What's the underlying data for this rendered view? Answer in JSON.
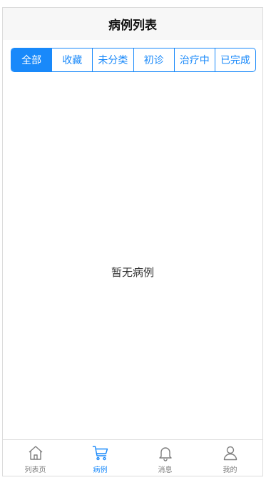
{
  "header": {
    "title": "病例列表"
  },
  "segments": [
    {
      "label": "全部",
      "active": true
    },
    {
      "label": "收藏",
      "active": false
    },
    {
      "label": "未分类",
      "active": false
    },
    {
      "label": "初诊",
      "active": false
    },
    {
      "label": "治疗中",
      "active": false
    },
    {
      "label": "已完成",
      "active": false
    }
  ],
  "empty_state": {
    "text": "暂无病例"
  },
  "tabbar": {
    "items": [
      {
        "label": "列表页",
        "icon": "home-icon",
        "active": false
      },
      {
        "label": "病例",
        "icon": "cart-icon",
        "active": true
      },
      {
        "label": "消息",
        "icon": "bell-icon",
        "active": false
      },
      {
        "label": "我的",
        "icon": "user-icon",
        "active": false
      }
    ]
  },
  "colors": {
    "accent": "#1989fa",
    "navbar_bg": "#f7f7f7",
    "inactive_text": "#7d7d7d"
  }
}
